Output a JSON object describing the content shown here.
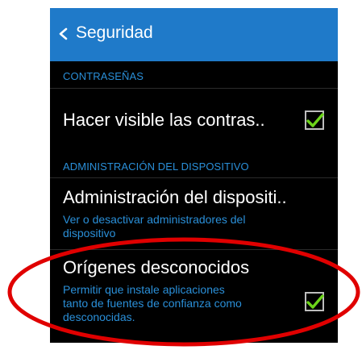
{
  "header": {
    "back_icon": "chevron-left-icon",
    "title": "Seguridad",
    "background": "#1f7ac9"
  },
  "sections": {
    "passwords": {
      "label": "CONTRASEÑAS",
      "items": [
        {
          "title": "Hacer visible las contras..",
          "checked": true
        }
      ]
    },
    "device_admin": {
      "label": "ADMINISTRACIÓN DEL DISPOSITIVO",
      "items": [
        {
          "title": "Administración del dispositi..",
          "subtitle_line1": "Ver o desactivar administradores del",
          "subtitle_line2": "dispositivo"
        },
        {
          "title": "Orígenes desconocidos",
          "subtitle_line1": "Permitir que instale aplicaciones",
          "subtitle_line2": "tanto de fuentes de confianza como",
          "subtitle_line3": "desconocidas.",
          "checked": true
        }
      ]
    }
  },
  "colors": {
    "accent": "#2a8fd8",
    "check": "#6cd41a",
    "annotation": "#e00000"
  }
}
